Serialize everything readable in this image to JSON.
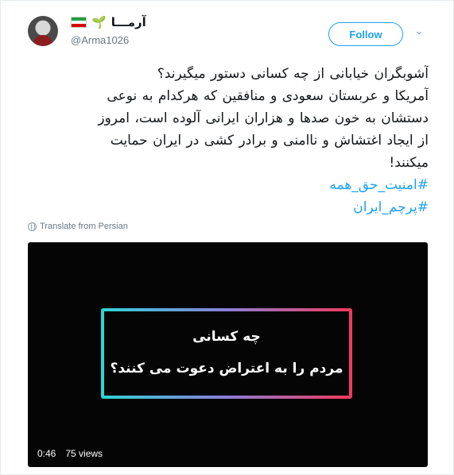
{
  "user": {
    "display_name": "آرمـــا",
    "handle": "@Arma1026",
    "flag_colors": [
      "#239f40",
      "#ffffff",
      "#da0000"
    ]
  },
  "follow_label": "Follow",
  "tweet": {
    "lines": [
      "آشوبگران خیابانی از چه کسانی دستور میگیرند؟",
      "آمریکا و عربستان سعودی و منافقین که هرکدام به نوعی",
      "دستشان به خون صدها و هزاران ایرانی آلوده است، امروز",
      "از  ایجاد اغتشاش و ناامنی و برادر کشی در ایران حمایت",
      "میکنند!"
    ],
    "hashtags": [
      "#امنیت_حق_همه",
      "#پرچم_ایران"
    ]
  },
  "translate_label": "Translate from Persian",
  "video": {
    "title_line1": "چه کسانی",
    "title_line2": "مردم را به اعتراض دعوت می کنند؟",
    "duration": "0:46",
    "views": "75 views",
    "frame_gradient": [
      "#2fd4d6",
      "#f23a5c"
    ]
  }
}
